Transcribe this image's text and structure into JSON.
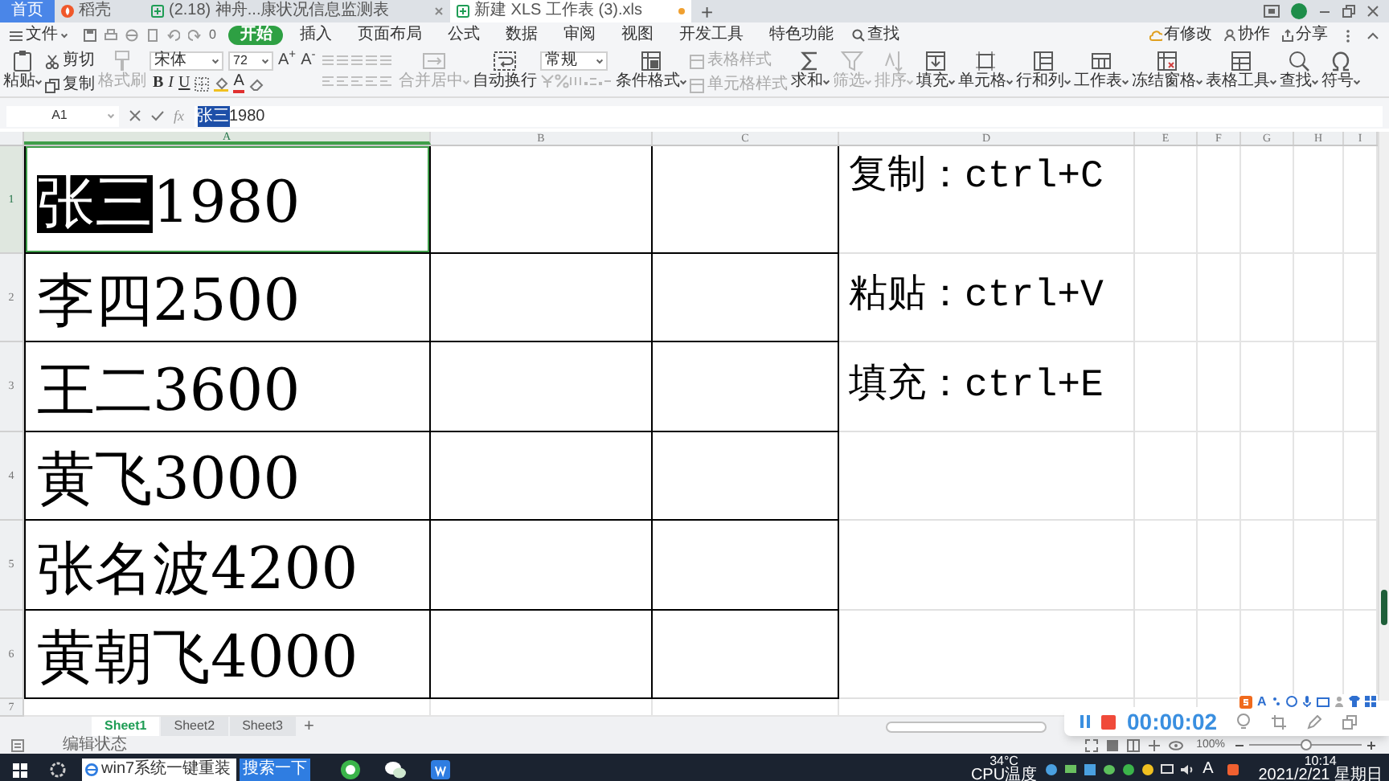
{
  "browser_tabs": [
    {
      "kind": "home",
      "label": "首页",
      "selected": false
    },
    {
      "kind": "docer",
      "label": "稻壳",
      "selected": false
    },
    {
      "kind": "sheet",
      "label": "(2.18) 神舟...康状况信息监测表",
      "selected": false,
      "modified": false
    },
    {
      "kind": "sheet",
      "label": "新建 XLS 工作表 (3).xls",
      "selected": true,
      "modified": true
    }
  ],
  "new_tab": "+",
  "menu": {
    "file": "文件",
    "quick_access_text": "0",
    "tabs": [
      {
        "label": "开始",
        "selected": true
      },
      {
        "label": "插入",
        "selected": false
      },
      {
        "label": "页面布局",
        "selected": false
      },
      {
        "label": "公式",
        "selected": false
      },
      {
        "label": "数据",
        "selected": false
      },
      {
        "label": "审阅",
        "selected": false
      },
      {
        "label": "视图",
        "selected": false
      },
      {
        "label": "开发工具",
        "selected": false
      },
      {
        "label": "特色功能",
        "selected": false
      }
    ],
    "search": "查找",
    "actions": [
      "有修改",
      "协作",
      "分享"
    ]
  },
  "ribbon": {
    "groups": [
      {
        "kind": "large",
        "label": "粘贴",
        "disabled": false,
        "dropdown": true
      },
      {
        "kind": "stack",
        "items": [
          {
            "label": "剪切",
            "disabled": false
          },
          {
            "label": "复制",
            "disabled": false
          }
        ]
      },
      {
        "kind": "large",
        "label": "格式刷",
        "disabled": true,
        "dropdown": false
      },
      {
        "kind": "font",
        "font_name": "宋体",
        "font_size": "72",
        "size_buttons": [
          "A$^{+}$",
          "A$^{-}$"
        ],
        "style_buttons": [
          "B",
          "I",
          "U"
        ],
        "color_button": "A"
      },
      {
        "kind": "align"
      },
      {
        "kind": "large",
        "label": "合并居中",
        "disabled": true,
        "dropdown": true
      },
      {
        "kind": "large",
        "label": "自动换行",
        "disabled": false,
        "dropdown": false
      },
      {
        "kind": "number",
        "format": "常规"
      },
      {
        "kind": "large",
        "label": "条件格式",
        "disabled": false,
        "dropdown": true
      },
      {
        "kind": "stack",
        "items": [
          {
            "label": "表格样式",
            "disabled": true
          },
          {
            "label": "单元格样式",
            "disabled": true
          }
        ]
      },
      {
        "kind": "large",
        "label": "求和",
        "disabled": false,
        "dropdown": true
      },
      {
        "kind": "large",
        "label": "筛选",
        "disabled": true,
        "dropdown": true
      },
      {
        "kind": "large",
        "label": "排序",
        "disabled": true,
        "dropdown": true
      },
      {
        "kind": "large",
        "label": "填充",
        "disabled": false,
        "dropdown": true
      },
      {
        "kind": "large",
        "label": "单元格",
        "disabled": false,
        "dropdown": true
      },
      {
        "kind": "large",
        "label": "行和列",
        "disabled": false,
        "dropdown": true
      },
      {
        "kind": "large",
        "label": "工作表",
        "disabled": false,
        "dropdown": true
      },
      {
        "kind": "large",
        "label": "冻结窗格",
        "disabled": false,
        "dropdown": true
      },
      {
        "kind": "large",
        "label": "表格工具",
        "disabled": false,
        "dropdown": true
      },
      {
        "kind": "large",
        "label": "查找",
        "disabled": false,
        "dropdown": true
      },
      {
        "kind": "large",
        "label": "符号",
        "disabled": false,
        "dropdown": true
      }
    ]
  },
  "formula_bar": {
    "name_box": "A1",
    "fx": "fx",
    "segments": [
      {
        "text": "张三",
        "selected": true
      },
      {
        "text": "1980",
        "selected": false
      }
    ]
  },
  "sheet": {
    "columns": [
      "A",
      "B",
      "C",
      "D",
      "E",
      "F",
      "G",
      "H",
      "I"
    ],
    "rows": [
      {
        "header": "1",
        "a": {
          "segments": [
            {
              "text": "张三",
              "selected": true
            },
            {
              "text": "1980",
              "selected": false
            }
          ],
          "selected": true
        },
        "d": "复制：ctrl+C"
      },
      {
        "header": "2",
        "a": {
          "segments": [
            {
              "text": "李四2500",
              "selected": false
            }
          ],
          "selected": false
        },
        "d": "粘贴：ctrl+V"
      },
      {
        "header": "3",
        "a": {
          "segments": [
            {
              "text": "王二3600",
              "selected": false
            }
          ],
          "selected": false
        },
        "d": "填充：ctrl+E"
      },
      {
        "header": "4",
        "a": {
          "segments": [
            {
              "text": "黄飞3000",
              "selected": false
            }
          ],
          "selected": false
        }
      },
      {
        "header": "5",
        "a": {
          "segments": [
            {
              "text": "张名波4200",
              "selected": false
            }
          ],
          "selected": false
        }
      },
      {
        "header": "6",
        "a": {
          "segments": [
            {
              "text": "黄朝飞4000",
              "selected": false
            }
          ],
          "selected": false
        }
      },
      {
        "header": "7"
      }
    ]
  },
  "sheet_tabs": [
    {
      "label": "Sheet1",
      "selected": true
    },
    {
      "label": "Sheet2",
      "selected": false
    },
    {
      "label": "Sheet3",
      "selected": false
    }
  ],
  "add_sheet": "+",
  "status_bar": {
    "mode": "编辑状态",
    "zoom": "100%",
    "zoom_slider": {
      "level": 0.5
    }
  },
  "recorder": {
    "time": "00:00:02"
  },
  "ime": {
    "mode": "A"
  },
  "taskbar": {
    "search": "win7系统一键重装",
    "search_button": "搜索一下",
    "temperature": "34°C",
    "temperature_label": "CPU温度",
    "ime_mode": "A",
    "time": "10:14",
    "date": "2021/2/21 星期日"
  }
}
